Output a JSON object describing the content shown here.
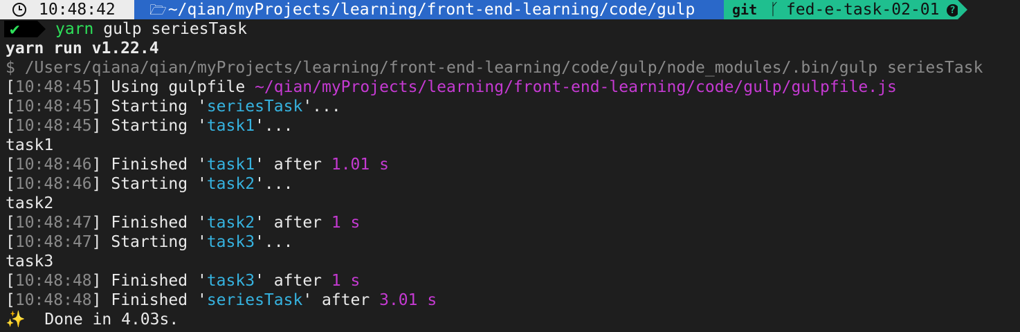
{
  "prompt": {
    "time": "10:48:42",
    "path": "~/qian/myProjects/learning/front-end-learning/code/gulp",
    "git_label": "git",
    "branch": "fed-e-task-02-01",
    "help_glyph": "?"
  },
  "command": {
    "status_glyph": "✔",
    "program": "yarn",
    "args": " gulp seriesTask"
  },
  "output": {
    "yarn_version": "yarn run v1.22.4",
    "exec_line": "$ /Users/qiana/qian/myProjects/learning/front-end-learning/code/gulp/node_modules/.bin/gulp seriesTask",
    "log": [
      {
        "time": "10:48:45",
        "text": "Using gulpfile ",
        "path": "~/qian/myProjects/learning/front-end-learning/code/gulp/gulpfile.js"
      },
      {
        "time": "10:48:45",
        "verb": "Starting",
        "task": "seriesTask"
      },
      {
        "time": "10:48:45",
        "verb": "Starting",
        "task": "task1"
      },
      {
        "plain": "task1"
      },
      {
        "time": "10:48:46",
        "verb": "Finished",
        "task": "task1",
        "duration": "1.01 s"
      },
      {
        "time": "10:48:46",
        "verb": "Starting",
        "task": "task2"
      },
      {
        "plain": "task2"
      },
      {
        "time": "10:48:47",
        "verb": "Finished",
        "task": "task2",
        "duration": "1 s"
      },
      {
        "time": "10:48:47",
        "verb": "Starting",
        "task": "task3"
      },
      {
        "plain": "task3"
      },
      {
        "time": "10:48:48",
        "verb": "Finished",
        "task": "task3",
        "duration": "1 s"
      },
      {
        "time": "10:48:48",
        "verb": "Finished",
        "task": "seriesTask",
        "duration": "3.01 s"
      }
    ],
    "done": {
      "glyph": "✨",
      "text": "  Done in 4.03s."
    }
  },
  "colors": {
    "background": "#1e1e1e",
    "timestamp": "#8a8a8a",
    "task": "#36b3e0",
    "duration": "#c53ad2",
    "path_segment": "#2a68c9",
    "git_segment": "#1fbf8f"
  }
}
